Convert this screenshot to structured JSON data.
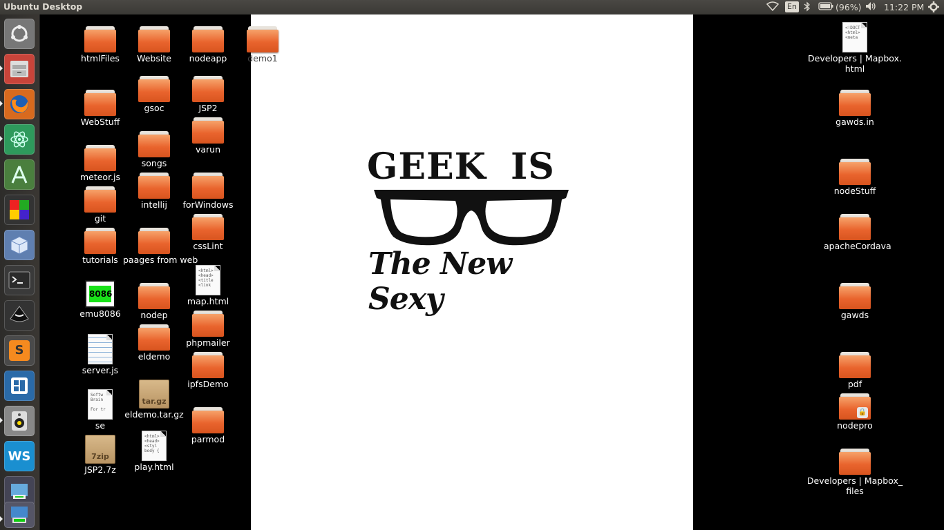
{
  "topbar": {
    "title": "Ubuntu Desktop",
    "lang": "En",
    "battery": "(96%)",
    "clock": "11:22 PM"
  },
  "launcher": {
    "items": [
      "dash-icon",
      "files-icon",
      "firefox-icon",
      "atom-icon",
      "android-studio-icon",
      "grid-app-icon",
      "virtualbox-icon",
      "terminal-icon",
      "inkscape-icon",
      "sublime-text-icon",
      "pinta-icon",
      "speaker-icon",
      "webstorm-icon",
      "installer-icon"
    ]
  },
  "wallpaper": {
    "line1": "GEEK IS",
    "line2": "The New Sexy"
  },
  "desktop": {
    "icons": [
      {
        "label": "htmlFiles",
        "type": "folder"
      },
      {
        "label": "Website",
        "type": "folder"
      },
      {
        "label": "nodeapp",
        "type": "folder"
      },
      {
        "label": "demo1",
        "type": "folder"
      },
      {
        "label": "WebStuff",
        "type": "folder"
      },
      {
        "label": "gsoc",
        "type": "folder"
      },
      {
        "label": "JSP2",
        "type": "folder"
      },
      {
        "label": "varun",
        "type": "folder"
      },
      {
        "label": "songs",
        "type": "folder"
      },
      {
        "label": "meteor.js",
        "type": "folder"
      },
      {
        "label": "intellij",
        "type": "folder"
      },
      {
        "label": "forWindows",
        "type": "folder"
      },
      {
        "label": "git",
        "type": "folder"
      },
      {
        "label": "cssLint",
        "type": "folder"
      },
      {
        "label": "tutorials",
        "type": "folder"
      },
      {
        "label": "paages from web",
        "type": "folder"
      },
      {
        "label": "map.html",
        "type": "doc",
        "preview": "<html>\n<head>\n<title\n<link"
      },
      {
        "label": "emu8086",
        "type": "chip",
        "badge": "8086"
      },
      {
        "label": "nodep",
        "type": "folder"
      },
      {
        "label": "phpmailer",
        "type": "folder"
      },
      {
        "label": "eldemo",
        "type": "folder"
      },
      {
        "label": "server.js",
        "type": "doc",
        "preview": ""
      },
      {
        "label": "ipfsDemo",
        "type": "folder"
      },
      {
        "label": "eldemo.tar.gz",
        "type": "archive",
        "badge": "tar.gz"
      },
      {
        "label": "se",
        "type": "doc",
        "preview": "Softw\nBrain\n\nFor tr"
      },
      {
        "label": "parmod",
        "type": "folder"
      },
      {
        "label": "JSP2.7z",
        "type": "archive",
        "badge": "7zip"
      },
      {
        "label": "play.html",
        "type": "doc",
        "preview": "<html>\n<head>\n<styl\nbody {"
      },
      {
        "label": "Developers | Mapbox.\nhtml",
        "type": "doc",
        "preview": "<!DOCT\n<html>\n<meta"
      },
      {
        "label": "gawds.in",
        "type": "folder"
      },
      {
        "label": "nodeStuff",
        "type": "folder"
      },
      {
        "label": "apacheCordava",
        "type": "folder"
      },
      {
        "label": "gawds",
        "type": "folder"
      },
      {
        "label": "pdf",
        "type": "folder"
      },
      {
        "label": "nodepro",
        "type": "folder-locked"
      },
      {
        "label": "Developers | Mapbox_\nfiles",
        "type": "folder"
      }
    ]
  }
}
